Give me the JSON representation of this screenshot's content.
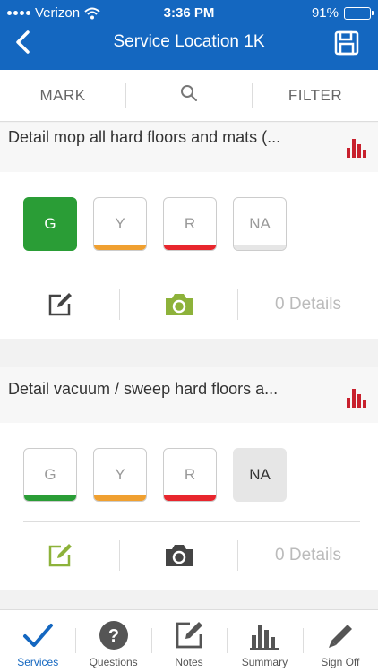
{
  "status": {
    "carrier": "Verizon",
    "time": "3:36 PM",
    "battery": "91%",
    "battery_level": 0.91
  },
  "header": {
    "title": "Service Location 1K"
  },
  "toolbar": {
    "mark": "MARK",
    "filter": "FILTER"
  },
  "tasks": [
    {
      "title": "Detail mop all hard floors and mats (...",
      "ratings": [
        "G",
        "Y",
        "R",
        "NA"
      ],
      "selected": "G",
      "details": "0 Details"
    },
    {
      "title": "Detail vacuum / sweep hard floors a...",
      "ratings": [
        "G",
        "Y",
        "R",
        "NA"
      ],
      "selected": "NA",
      "details": "0 Details"
    }
  ],
  "tabs": [
    {
      "label": "Services",
      "icon": "checkmark-icon",
      "active": true
    },
    {
      "label": "Questions",
      "icon": "question-icon"
    },
    {
      "label": "Notes",
      "icon": "notes-icon"
    },
    {
      "label": "Summary",
      "icon": "bar-chart-icon"
    },
    {
      "label": "Sign Off",
      "icon": "pen-icon"
    }
  ],
  "colors": {
    "brand": "#1467c0",
    "green": "#2a9d36",
    "yellow": "#f0a030",
    "red": "#e8262d",
    "chart": "#c8202d",
    "olive": "#8db23a"
  }
}
